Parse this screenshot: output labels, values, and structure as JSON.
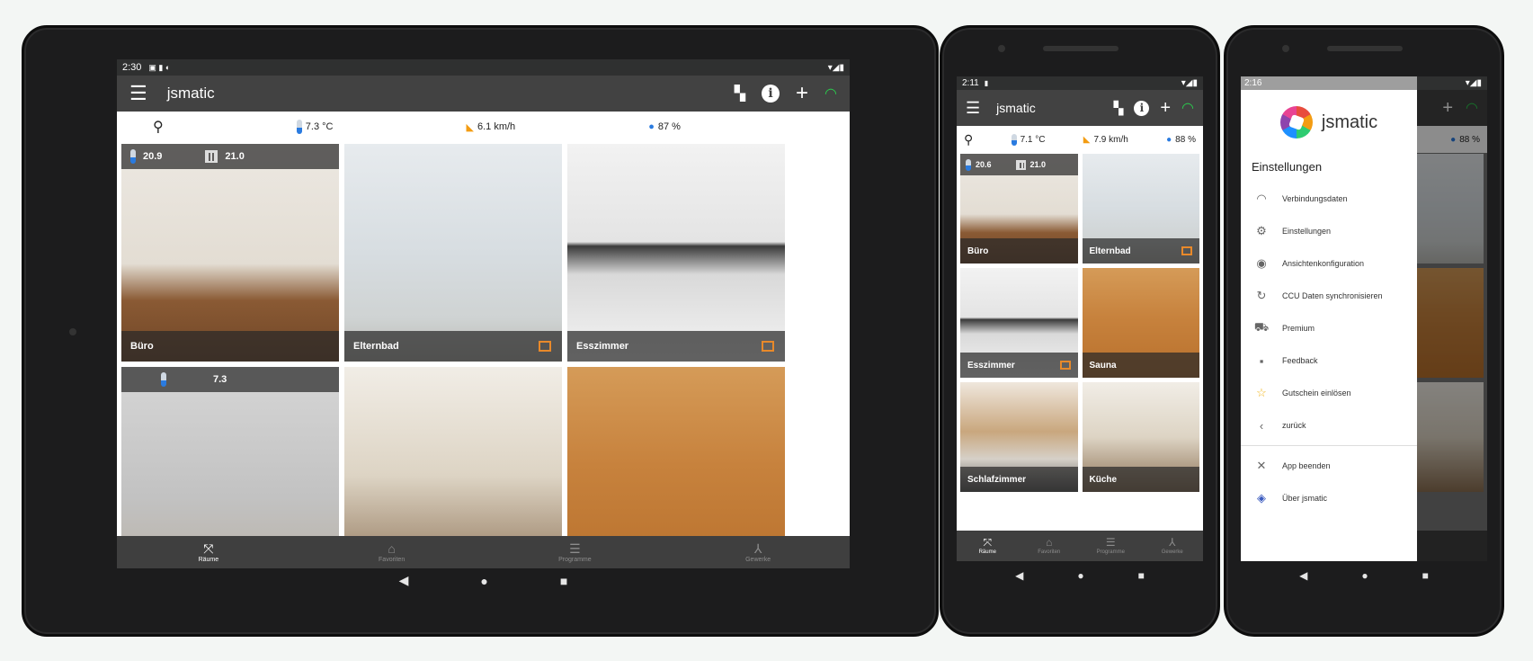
{
  "app_title": "jsmatic",
  "tablet": {
    "time": "2:30",
    "weather": {
      "temp": "7.3 °C",
      "wind": "6.1 km/h",
      "humidity": "87 %"
    },
    "rooms": [
      {
        "name": "Büro",
        "temp": "20.9",
        "heater": "21.0"
      },
      {
        "name": "Elternbad"
      },
      {
        "name": "Esszimmer"
      },
      {
        "name": "",
        "temp": "7.3"
      },
      {
        "name": ""
      },
      {
        "name": ""
      }
    ]
  },
  "phone1": {
    "time": "2:11",
    "weather": {
      "temp": "7.1 °C",
      "wind": "7.9 km/h",
      "humidity": "88 %"
    },
    "rooms": [
      {
        "name": "Büro",
        "temp": "20.6",
        "heater": "21.0"
      },
      {
        "name": "Elternbad"
      },
      {
        "name": "Esszimmer"
      },
      {
        "name": "Sauna"
      },
      {
        "name": "Schlafzimmer"
      },
      {
        "name": "Küche"
      }
    ]
  },
  "phone2": {
    "time": "2:16",
    "humidity": "88 %",
    "drawer": {
      "brand": "jsmatic",
      "heading": "Einstellungen",
      "items": [
        {
          "label": "Verbindungsdaten",
          "icon": "wifi-icon"
        },
        {
          "label": "Einstellungen",
          "icon": "gear-icon"
        },
        {
          "label": "Ansichtenkonfiguration",
          "icon": "eye-icon"
        },
        {
          "label": "CCU Daten synchronisieren",
          "icon": "sync-icon"
        },
        {
          "label": "Premium",
          "icon": "cart-icon"
        },
        {
          "label": "Feedback",
          "icon": "feedback-icon"
        },
        {
          "label": "Gutschein einlösen",
          "icon": "star-icon"
        },
        {
          "label": "zurück",
          "icon": "back-icon"
        }
      ],
      "footer_items": [
        {
          "label": "App beenden",
          "icon": "close-icon"
        },
        {
          "label": "Über jsmatic",
          "icon": "diamond-icon"
        }
      ]
    }
  },
  "bottom_nav": [
    "Räume",
    "Favoriten",
    "Programme",
    "Gewerke"
  ],
  "colors": {
    "accent_wifi": "#2bc94d",
    "appbar": "#424242",
    "camera": "#e8892a"
  }
}
